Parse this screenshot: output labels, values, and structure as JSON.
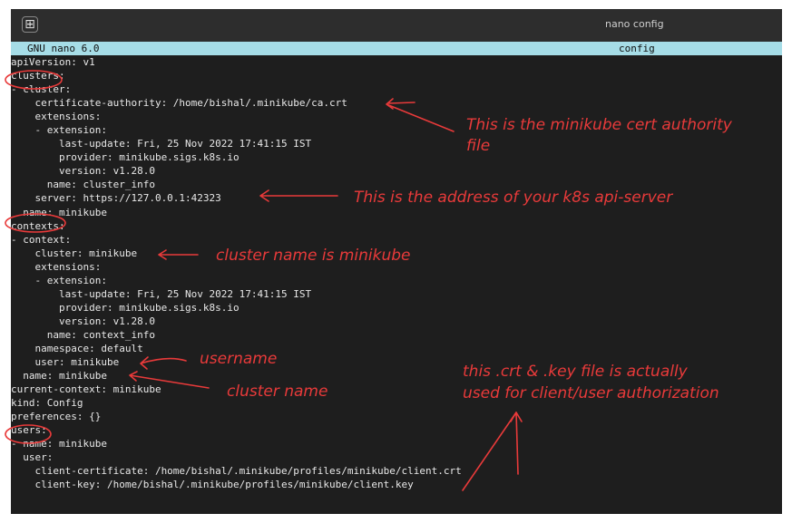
{
  "window": {
    "title": "nano config",
    "new_tab_glyph": "⊞"
  },
  "nano_status": {
    "version": "GNU nano 6.0",
    "filename": "config"
  },
  "lines": [
    "apiVersion: v1",
    "clusters:",
    "- cluster:",
    "    certificate-authority: /home/bishal/.minikube/ca.crt",
    "    extensions:",
    "    - extension:",
    "        last-update: Fri, 25 Nov 2022 17:41:15 IST",
    "        provider: minikube.sigs.k8s.io",
    "        version: v1.28.0",
    "      name: cluster_info",
    "    server: https://127.0.0.1:42323",
    "  name: minikube",
    "contexts:",
    "- context:",
    "    cluster: minikube",
    "    extensions:",
    "    - extension:",
    "        last-update: Fri, 25 Nov 2022 17:41:15 IST",
    "        provider: minikube.sigs.k8s.io",
    "        version: v1.28.0",
    "      name: context_info",
    "    namespace: default",
    "    user: minikube",
    "  name: minikube",
    "current-context: minikube",
    "kind: Config",
    "preferences: {}",
    "users:",
    "- name: minikube",
    "  user:",
    "    client-certificate: /home/bishal/.minikube/profiles/minikube/client.crt",
    "    client-key: /home/bishal/.minikube/profiles/minikube/client.key"
  ],
  "annotations": {
    "ca_note_1": "This is the minikube cert authority",
    "ca_note_2": "file",
    "server_note": "This is the address of your k8s api-server",
    "cluster_note": "cluster name is minikube",
    "username_note": "username",
    "clustername_note": "cluster name",
    "client_note_1": "this .crt & .key file is actually",
    "client_note_2": "used for client/user authorization"
  },
  "colors": {
    "annotation": "#e83a3a",
    "status_bar": "#a6dde7",
    "terminal_bg": "#1e1e1e"
  }
}
